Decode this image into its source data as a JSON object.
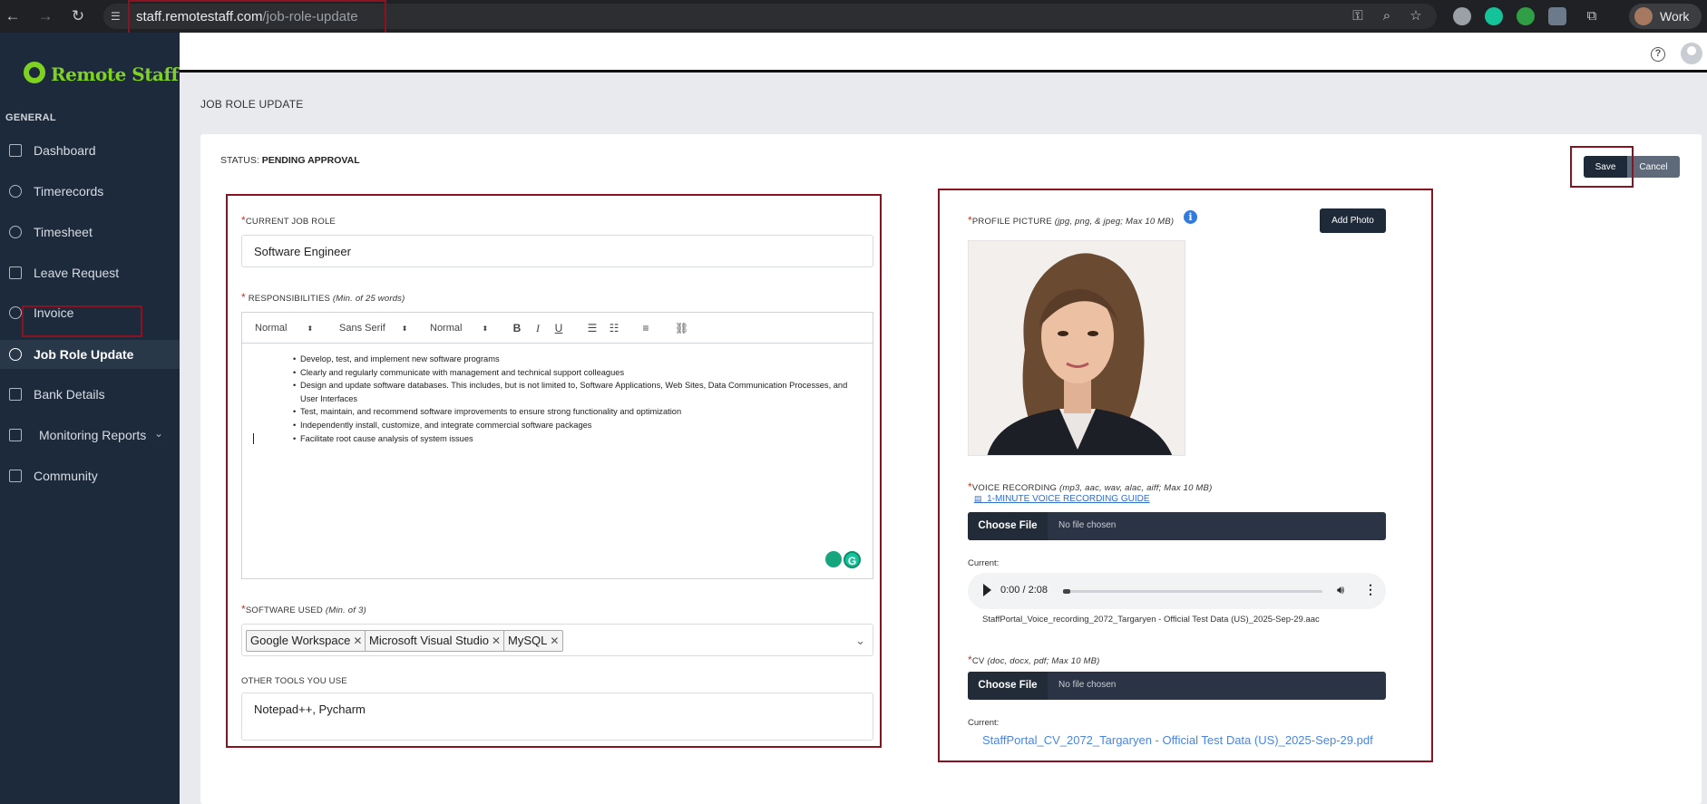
{
  "browser": {
    "url_domain": "staff.remotestaff.com",
    "url_path": "/job-role-update",
    "profile_name": "Work"
  },
  "sidebar": {
    "brand": "Remote Staff",
    "section": "GENERAL",
    "items": [
      {
        "label": "Dashboard",
        "icon": "home-icon"
      },
      {
        "label": "Timerecords",
        "icon": "clock-icon"
      },
      {
        "label": "Timesheet",
        "icon": "clock-icon"
      },
      {
        "label": "Leave Request",
        "icon": "calendar-icon"
      },
      {
        "label": "Invoice",
        "icon": "dollar-icon"
      },
      {
        "label": "Job Role Update",
        "icon": "check-circle-icon",
        "active": true
      },
      {
        "label": "Bank Details",
        "icon": "card-icon"
      },
      {
        "label": "Monitoring Reports",
        "icon": "report-icon",
        "has_submenu": true
      },
      {
        "label": "Community",
        "icon": "community-icon"
      }
    ]
  },
  "page": {
    "title": "JOB ROLE UPDATE",
    "status_label": "STATUS:",
    "status_value": "PENDING APPROVAL",
    "save_label": "Save",
    "cancel_label": "Cancel"
  },
  "form": {
    "current_job_role_label": "CURRENT JOB ROLE",
    "current_job_role_value": "Software Engineer",
    "responsibilities_label": "RESPONSIBILITIES",
    "responsibilities_hint": "(Min. of 25 words)",
    "toolbar": {
      "heading": "Normal",
      "font": "Sans Serif",
      "size": "Normal"
    },
    "responsibilities": [
      "Develop, test, and implement new software programs",
      "Clearly and regularly communicate with management and technical support colleagues",
      "Design and update software databases. This includes, but is not limited to, Software Applications, Web Sites, Data Communication Processes, and User Interfaces",
      "Test, maintain, and recommend software improvements to ensure strong functionality and optimization",
      "Independently install, customize, and integrate commercial software packages",
      "Facilitate root cause analysis of system issues"
    ],
    "software_label": "SOFTWARE USED",
    "software_hint": "(Min. of 3)",
    "software": [
      "Google Workspace",
      "Microsoft Visual Studio",
      "MySQL"
    ],
    "other_tools_label": "OTHER TOOLS YOU USE",
    "other_tools_value": "Notepad++, Pycharm",
    "profile_picture_label": "PROFILE PICTURE",
    "profile_picture_hint": "(jpg, png, & jpeg; Max 10 MB)",
    "add_photo_label": "Add Photo",
    "voice_label": "VOICE RECORDING",
    "voice_hint": "(mp3, aac, wav, alac, aiff; Max 10 MB)",
    "voice_guide_link": "1-MINUTE VOICE RECORDING GUIDE",
    "choose_file_label": "Choose File",
    "no_file_label": "No file chosen",
    "current_label": "Current:",
    "audio_time": "0:00 / 2:08",
    "voice_file_name": "StaffPortal_Voice_recording_2072_Targaryen - Official Test Data (US)_2025-Sep-29.aac",
    "cv_label": "CV",
    "cv_hint": "(doc, docx, pdf; Max 10 MB)",
    "cv_file_name": "StaffPortal_CV_2072_Targaryen - Official Test Data (US)_2025-Sep-29.pdf"
  }
}
